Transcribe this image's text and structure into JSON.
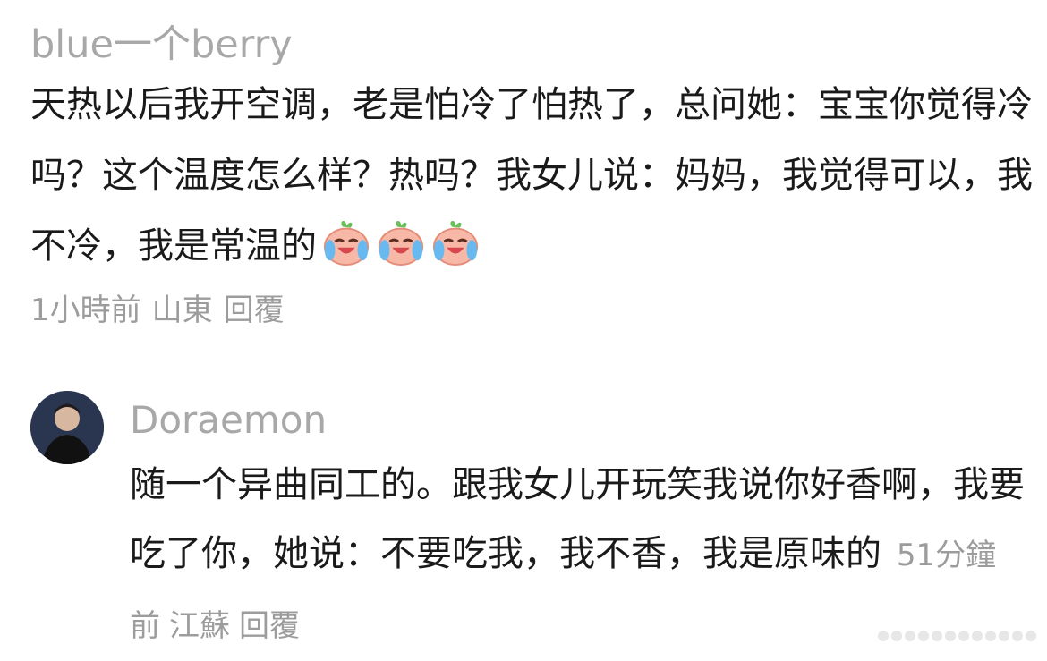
{
  "comment": {
    "username": "blue一个berry",
    "text": "天热以后我开空调，老是怕冷了怕热了，总问她：宝宝你觉得冷吗？这个温度怎么样？热吗？我女儿说：妈妈，我觉得可以，我不冷，我是常温的",
    "emojis": [
      "laugh-cry-peach-icon",
      "laugh-cry-peach-icon",
      "laugh-cry-peach-icon"
    ],
    "time": "1小時前",
    "location": "山東",
    "reply_label": "回覆"
  },
  "reply": {
    "username": "Doraemon",
    "text": "随一个异曲同工的。跟我女儿开玩笑我说你好香啊，我要吃了你，她说：不要吃我，我不香，我是原味的",
    "time": "51分鐘前",
    "location": "江蘇",
    "reply_label": "回覆",
    "avatar": "avatar"
  },
  "colors": {
    "text": "#1a1a1a",
    "muted": "#9c9c9c",
    "username": "#a8a8a8"
  }
}
